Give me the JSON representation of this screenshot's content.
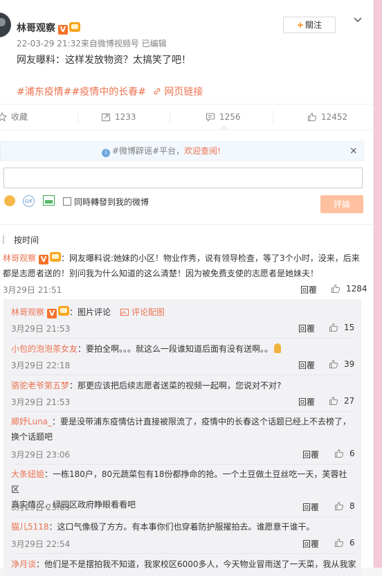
{
  "post": {
    "author": "林哥观察",
    "meta": "22-03-29 21:32来自微博视频号  已编辑",
    "follow_label": "關注",
    "text": "网友曝料：这样发放物资？太搞笑了吧！",
    "tag1": "#浦东疫情#",
    "tag2": "#疫情中的长春#",
    "link": "网页链接"
  },
  "actions": {
    "collect": "收藏",
    "repost": "1233",
    "comment": "1256",
    "like": "12452"
  },
  "notice": {
    "tag": "#微博辟谣#平台，",
    "highlight": "欢迎查阅!",
    "close": "×"
  },
  "composer": {
    "gif_label": "GIF",
    "repost_check": "同時轉發到我的微博",
    "submit": "評論"
  },
  "sort_label": "按时间",
  "main_comment": {
    "author": "林哥观察",
    "line1": "：网友曝料说:她妹的小区！物业作秀，说有领导检查，等了3个小时，没来，后来",
    "line2": "都是志愿者送的！别问我为什么知道的这么清楚！因为被免费支使的志愿者是她妹夫！",
    "time": "3月29日 21:51",
    "reply": "回覆",
    "likes": "1284"
  },
  "replies": [
    {
      "name": "林哥观察",
      "text": "：图片评论",
      "extra": "评论配图",
      "time": "3月29日 21:53",
      "reply": "回覆",
      "likes": "15"
    },
    {
      "name": "小包的泡泡茶女友",
      "text": "：要拍全啊。。。就这么一段谁知道后面有没有送啊。。",
      "time": "3月29日 22:18",
      "reply": "回覆",
      "likes": "39"
    },
    {
      "name": "骆驼老爷第五梦",
      "text": "：那更应该把后续志愿者送菜的视频一起啊，您说对不对?",
      "time": "3月29日 21:53",
      "reply": "回覆",
      "likes": "27"
    },
    {
      "name": "卿妤Luna_",
      "text": "：要是没带浦东疫情估计直接被限流了，疫情中的长春这个话题已经上不去榜了，",
      "line2": "换个话题吧",
      "time": "3月29日 23:06",
      "reply": "回覆",
      "likes": "6"
    },
    {
      "name": "大条妞姐",
      "text": "：一栋180户，80元蔬菜包有18份都挣命的抢。一个土豆做土豆丝吃一天，芙蓉社区",
      "line2": "真实情况，绿园区政府睁眼看看吧",
      "time": "3月29日 23:03",
      "reply": "回覆",
      "likes": "8"
    },
    {
      "name": "猫儿5118",
      "text": "：这口气像极了方方。有本事你们也穿着防护服擢拍去。谁愿意干谁干。",
      "time": "3月29日 22:54",
      "reply": "回覆",
      "likes": "6"
    },
    {
      "name": "净月谈",
      "text": "：他们是不是摆拍我不知道，我家校区6000多人，今天物业冒雨送了一天菜，我从我家"
    }
  ],
  "colors": {
    "accent": "#eb7350",
    "follow_plus": "#ff8200",
    "submit_bg": "#ffc09f",
    "notice_bg": "#f2f8fd"
  },
  "icons": [
    "star-icon",
    "repost-icon",
    "comment-icon",
    "thumb-up-icon",
    "info-icon",
    "smile-icon",
    "gif-icon",
    "image-icon",
    "chevron-down-icon",
    "link-icon",
    "image-comment-icon",
    "bulb-emoji-icon"
  ]
}
